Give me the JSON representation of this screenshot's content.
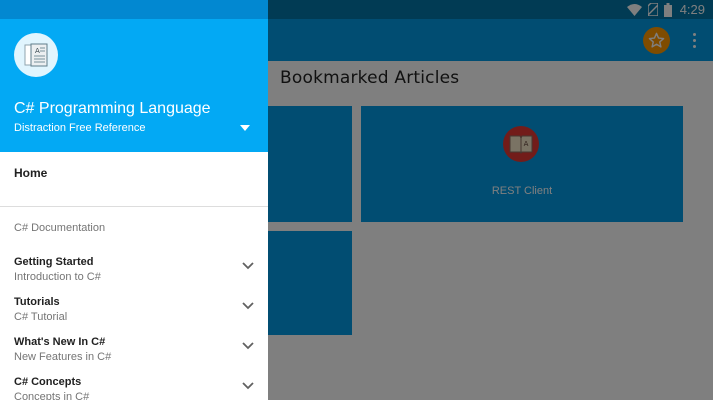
{
  "status_bar": {
    "time": "4:29",
    "icons": [
      "wifi-icon",
      "no-sim-icon",
      "battery-icon"
    ]
  },
  "main": {
    "section_title": "Bookmarked Articles",
    "cards": [
      {
        "label": ""
      },
      {
        "label": "REST Client",
        "icon": "book-icon"
      },
      {
        "label": ""
      }
    ]
  },
  "app_bar": {
    "actions": [
      "star-icon",
      "more-vert-icon"
    ]
  },
  "drawer": {
    "title": "C# Programming Language",
    "subtitle": "Distraction Free Reference",
    "home_label": "Home",
    "section_header": "C# Documentation",
    "items": [
      {
        "title": "Getting Started",
        "subtitle": "Introduction to C#"
      },
      {
        "title": "Tutorials",
        "subtitle": "C# Tutorial"
      },
      {
        "title": "What's New In C#",
        "subtitle": "New Features in C#"
      },
      {
        "title": "C# Concepts",
        "subtitle": "Concepts in C#"
      }
    ]
  },
  "colors": {
    "primary": "#039be5",
    "primary_dark": "#0288d1",
    "drawer_header": "#03a9f4",
    "accent": "#ff9800",
    "card_icon_bg": "#e53935"
  }
}
